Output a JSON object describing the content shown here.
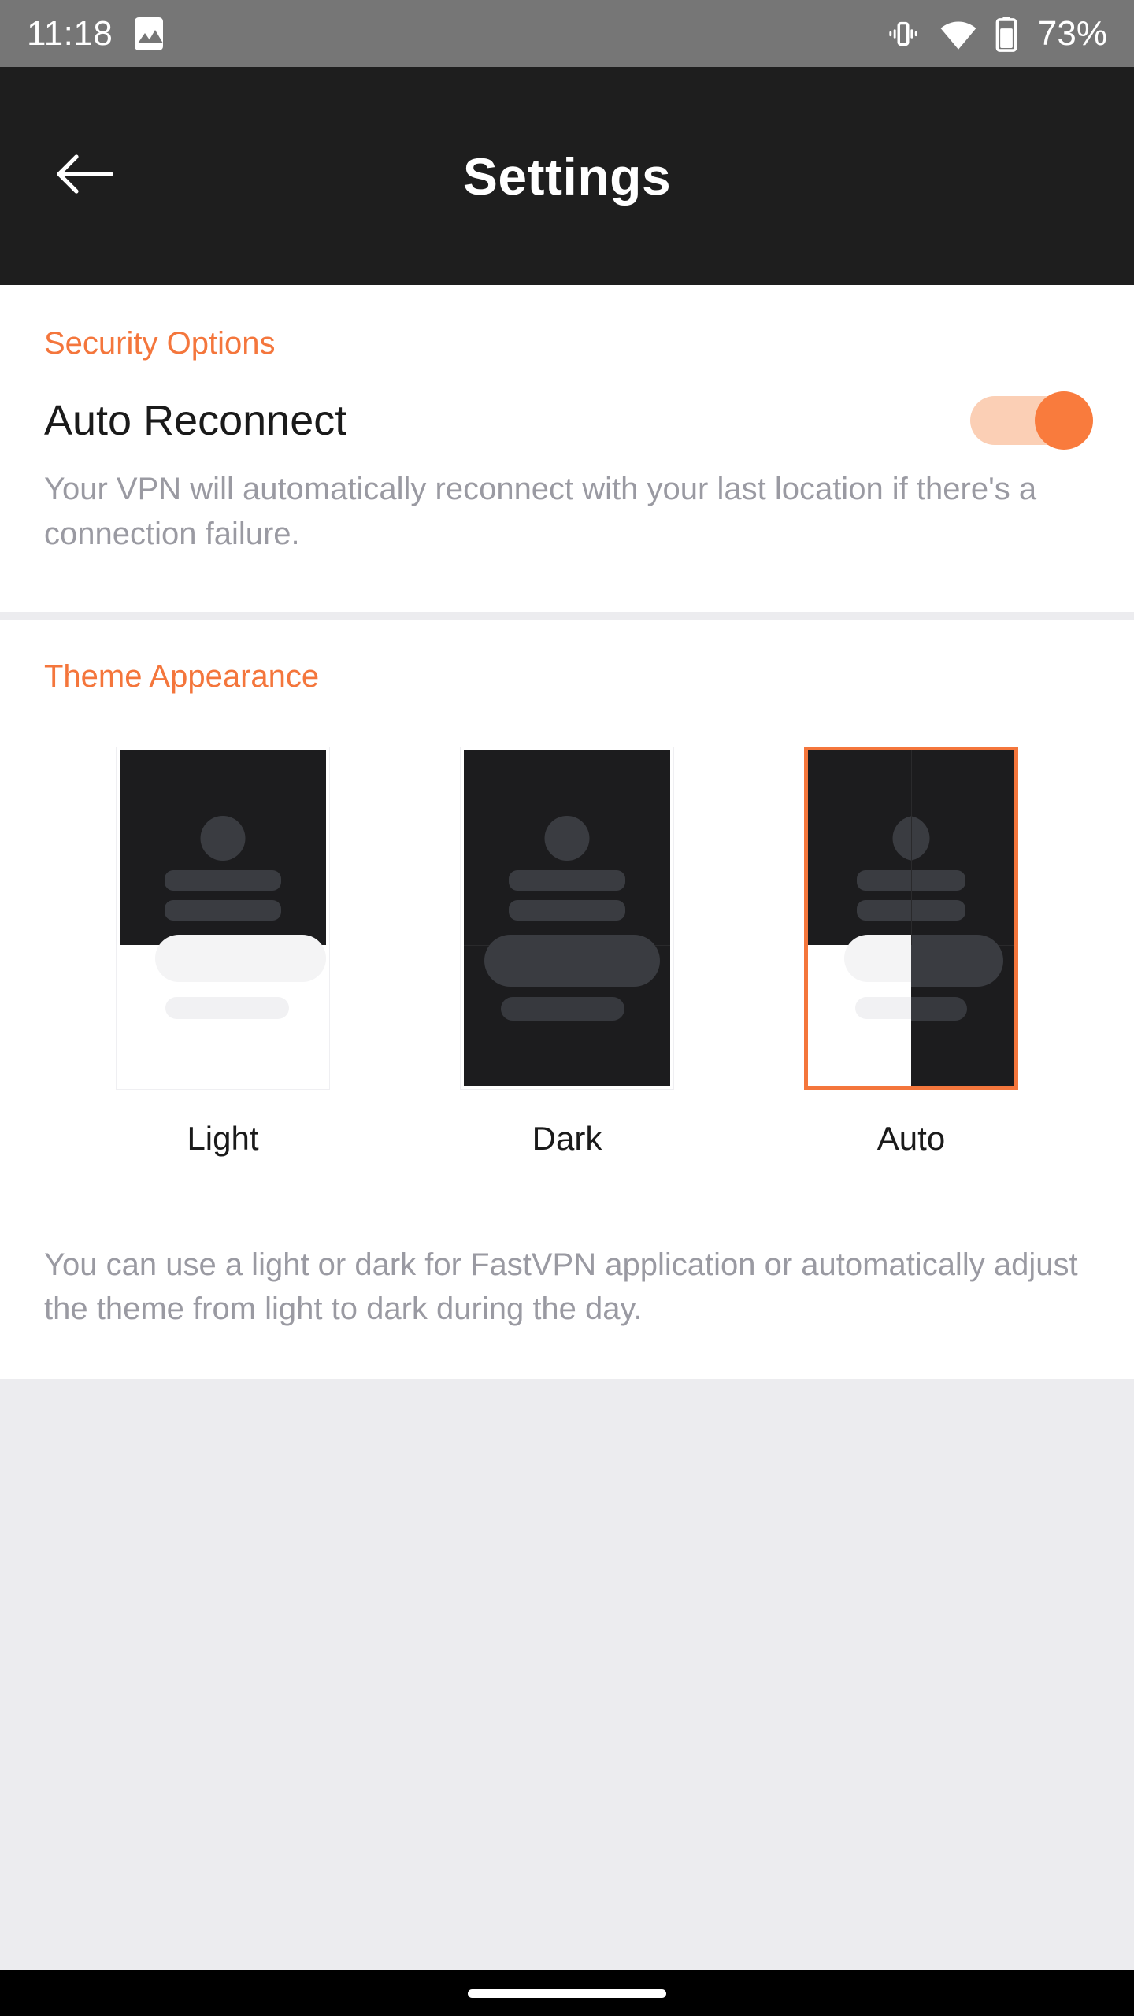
{
  "status_bar": {
    "time": "11:18",
    "photo_icon": "photo-icon",
    "vibrate_icon": "vibrate-icon",
    "wifi_icon": "wifi-icon",
    "battery_icon": "battery-icon",
    "battery_percent": "73%"
  },
  "header": {
    "back_icon": "back-arrow-icon",
    "title": "Settings"
  },
  "security": {
    "section_title": "Security Options",
    "auto_reconnect": {
      "label": "Auto Reconnect",
      "description": "Your VPN will automatically reconnect with your last location if there's a connection failure.",
      "toggle_state": "on"
    }
  },
  "theme": {
    "section_title": "Theme Appearance",
    "selected": "Auto",
    "options": [
      {
        "label": "Light",
        "mode": "light",
        "selected": false
      },
      {
        "label": "Dark",
        "mode": "dark",
        "selected": false
      },
      {
        "label": "Auto",
        "mode": "auto",
        "selected": true
      }
    ],
    "description": "You can use a light or dark for FastVPN application or automatically adjust the theme from light to dark during the day."
  },
  "nav_bar": {
    "home_indicator": "home-indicator-pill"
  },
  "colors": {
    "accent": "#F4763C",
    "toggle_track": "#FBCFB5",
    "toggle_thumb": "#F97B3D",
    "header_bg": "#1E1E1E",
    "status_bg": "#767676",
    "page_bg": "#ECECEF",
    "card_bg": "#FFFFFF",
    "muted_text": "#9A9AA2",
    "primary_text": "#1A1A1A",
    "preview_dark": "#1C1C1E"
  }
}
